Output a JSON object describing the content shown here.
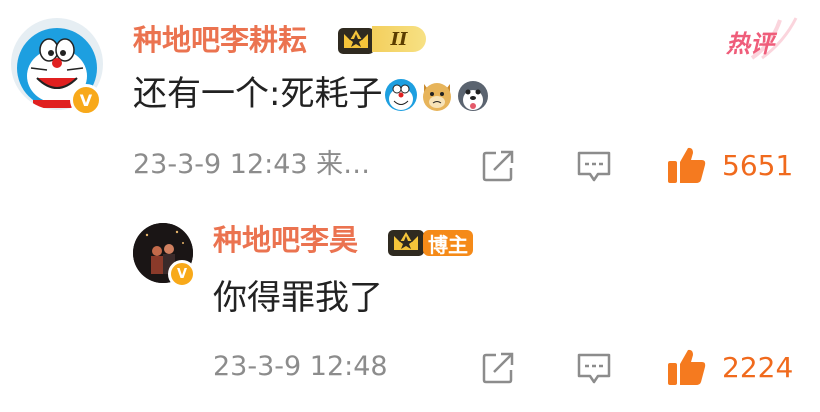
{
  "comments": [
    {
      "username": "种地吧李耕耘",
      "level": "II",
      "tag": "热评",
      "text": "还有一个:死耗子",
      "time": "23-3-9 12:43 来…",
      "likes": "5651"
    },
    {
      "username": "种地吧李昊",
      "badge": "博主",
      "text": "你得罪我了",
      "time": "23-3-9 12:48",
      "likes": "2224"
    }
  ],
  "verified_mark": "V",
  "colors": {
    "username": "#eb7350",
    "text": "#222222",
    "meta": "#8c8c8c",
    "like": "#f06a1d",
    "verified": "#f8a91a",
    "hot": "#ef5d7a"
  }
}
